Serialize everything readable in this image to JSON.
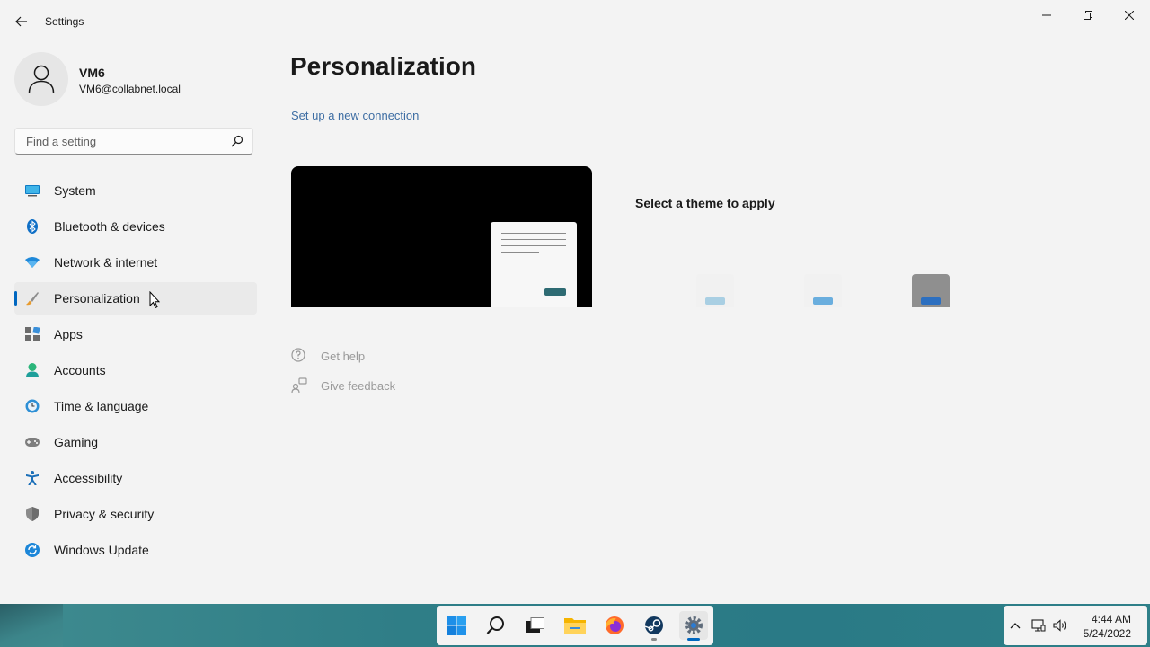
{
  "window": {
    "title": "Settings",
    "back_icon": "arrow-left-icon",
    "controls": [
      "minimize-icon",
      "restore-icon",
      "close-icon"
    ]
  },
  "profile": {
    "name": "VM6",
    "email": "VM6@collabnet.local",
    "avatar_icon": "person-icon"
  },
  "search": {
    "placeholder": "Find a setting",
    "value": ""
  },
  "sidebar": {
    "selected": "Personalization",
    "items": [
      {
        "label": "System",
        "icon": "monitor-icon"
      },
      {
        "label": "Bluetooth & devices",
        "icon": "bluetooth-icon"
      },
      {
        "label": "Network & internet",
        "icon": "wifi-icon"
      },
      {
        "label": "Personalization",
        "icon": "brush-icon"
      },
      {
        "label": "Apps",
        "icon": "apps-icon"
      },
      {
        "label": "Accounts",
        "icon": "accounts-icon"
      },
      {
        "label": "Time & language",
        "icon": "clock-globe-icon"
      },
      {
        "label": "Gaming",
        "icon": "gamepad-icon"
      },
      {
        "label": "Accessibility",
        "icon": "accessibility-icon"
      },
      {
        "label": "Privacy & security",
        "icon": "shield-icon"
      },
      {
        "label": "Windows Update",
        "icon": "update-icon"
      }
    ]
  },
  "main": {
    "title": "Personalization",
    "connection_link": "Set up a new connection",
    "theme_prompt": "Select a theme to apply",
    "help": [
      {
        "label": "Get help",
        "icon": "help-icon"
      },
      {
        "label": "Give feedback",
        "icon": "feedback-icon"
      }
    ]
  },
  "taskbar": {
    "apps": [
      "start-icon",
      "search-icon",
      "task-view-icon",
      "file-explorer-icon",
      "firefox-icon",
      "steam-icon",
      "settings-icon"
    ],
    "active_app": "settings-icon",
    "tray": [
      "chevron-up-icon",
      "network-icon",
      "volume-icon"
    ],
    "time": "4:44 AM",
    "date": "5/24/2022"
  },
  "colors": {
    "accent": "#0067c0",
    "link": "#3d6da3",
    "window_bg": "#f3f3f3",
    "taskbar": "#2f7e87"
  }
}
